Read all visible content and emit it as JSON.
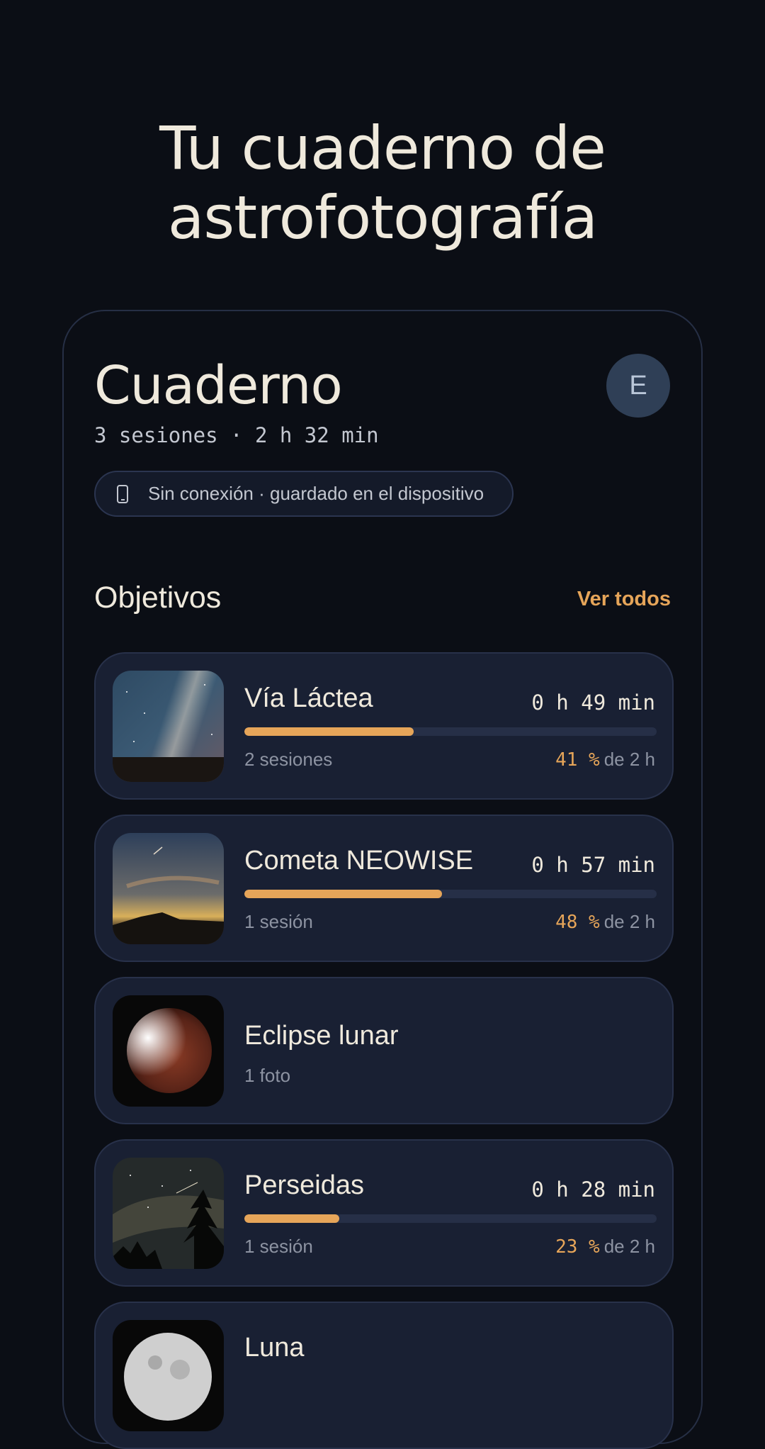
{
  "hero": {
    "line1": "Tu cuaderno de",
    "line2": "astrofotografía"
  },
  "header": {
    "title": "Cuaderno",
    "avatar_initial": "E",
    "summary": "3 sesiones · 2 h 32 min",
    "offline_label": "Sin conexión · guardado en el dispositivo",
    "offline_icon": "smartphone-icon"
  },
  "objectives": {
    "title": "Objetivos",
    "view_all": "Ver todos",
    "items": [
      {
        "name": "Vía Láctea",
        "time": "0 h 49 min",
        "progress": 0.41,
        "sub": "2 sesiones",
        "pct": "41 %",
        "goal": "de 2 h",
        "thumb": "milky-way-photo"
      },
      {
        "name": "Cometa NEOWISE",
        "time": "0 h 57 min",
        "progress": 0.48,
        "sub": "1 sesión",
        "pct": "48 %",
        "goal": "de 2 h",
        "thumb": "comet-photo"
      },
      {
        "name": "Eclipse lunar",
        "sub": "1 foto",
        "thumb": "lunar-eclipse-photo"
      },
      {
        "name": "Perseidas",
        "time": "0 h 28 min",
        "progress": 0.23,
        "sub": "1 sesión",
        "pct": "23 %",
        "goal": "de 2 h",
        "thumb": "perseids-photo"
      },
      {
        "name": "Luna",
        "thumb": "moon-photo"
      }
    ]
  },
  "colors": {
    "background": "#0b0e15",
    "card": "#192033",
    "accent": "#e6a559",
    "text": "#efe9dc",
    "muted": "#8d93a2"
  }
}
